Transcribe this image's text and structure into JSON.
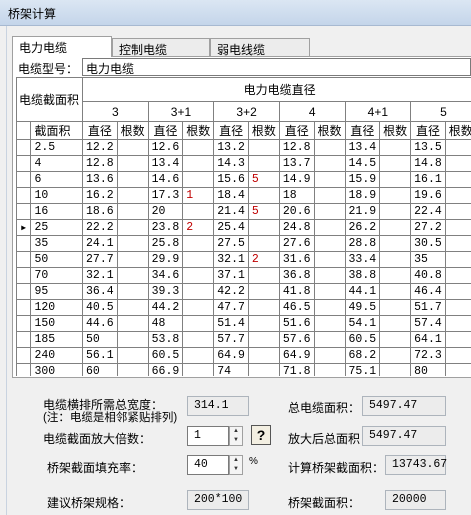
{
  "window": {
    "title": "桥架计算"
  },
  "tabs": [
    {
      "label": "电力电缆",
      "active": true
    },
    {
      "label": "控制电缆",
      "active": false
    },
    {
      "label": "弱电线缆",
      "active": false
    }
  ],
  "cable_type": {
    "label": "电缆型号：",
    "value": "电力电缆"
  },
  "grid": {
    "corner_label": "电缆截面积",
    "group_header": "电力电缆直径",
    "core_columns": [
      "3",
      "3+1",
      "3+2",
      "4",
      "4+1",
      "5"
    ],
    "sub_headers": {
      "area": "截面积",
      "diameter": "直径",
      "count": "根数"
    },
    "rows": [
      {
        "area": "2.5",
        "v": [
          "12.2",
          "",
          "12.6",
          "",
          "13.2",
          "",
          "12.8",
          "",
          "13.4",
          "",
          "13.5",
          ""
        ]
      },
      {
        "area": "4",
        "v": [
          "12.8",
          "",
          "13.4",
          "",
          "14.3",
          "",
          "13.7",
          "",
          "14.5",
          "",
          "14.8",
          ""
        ]
      },
      {
        "area": "6",
        "v": [
          "13.6",
          "",
          "14.6",
          "",
          "15.6",
          "5",
          "14.9",
          "",
          "15.9",
          "",
          "16.1",
          ""
        ]
      },
      {
        "area": "10",
        "v": [
          "16.2",
          "",
          "17.3",
          "1",
          "18.4",
          "",
          "18",
          "",
          "18.9",
          "",
          "19.6",
          ""
        ]
      },
      {
        "area": "16",
        "v": [
          "18.6",
          "",
          "20",
          "",
          "21.4",
          "5",
          "20.6",
          "",
          "21.9",
          "",
          "22.4",
          ""
        ]
      },
      {
        "area": "25",
        "v": [
          "22.2",
          "",
          "23.8",
          "2",
          "25.4",
          "",
          "24.8",
          "",
          "26.2",
          "",
          "27.2",
          ""
        ],
        "current": true
      },
      {
        "area": "35",
        "v": [
          "24.1",
          "",
          "25.8",
          "",
          "27.5",
          "",
          "27.6",
          "",
          "28.8",
          "",
          "30.5",
          ""
        ]
      },
      {
        "area": "50",
        "v": [
          "27.7",
          "",
          "29.9",
          "",
          "32.1",
          "2",
          "31.6",
          "",
          "33.4",
          "",
          "35",
          ""
        ]
      },
      {
        "area": "70",
        "v": [
          "32.1",
          "",
          "34.6",
          "",
          "37.1",
          "",
          "36.8",
          "",
          "38.8",
          "",
          "40.8",
          ""
        ]
      },
      {
        "area": "95",
        "v": [
          "36.4",
          "",
          "39.3",
          "",
          "42.2",
          "",
          "41.8",
          "",
          "44.1",
          "",
          "46.4",
          ""
        ]
      },
      {
        "area": "120",
        "v": [
          "40.5",
          "",
          "44.2",
          "",
          "47.7",
          "",
          "46.5",
          "",
          "49.5",
          "",
          "51.7",
          ""
        ]
      },
      {
        "area": "150",
        "v": [
          "44.6",
          "",
          "48",
          "",
          "51.4",
          "",
          "51.6",
          "",
          "54.1",
          "",
          "57.4",
          ""
        ]
      },
      {
        "area": "185",
        "v": [
          "50",
          "",
          "53.8",
          "",
          "57.7",
          "",
          "57.6",
          "",
          "60.5",
          "",
          "64.1",
          ""
        ]
      },
      {
        "area": "240",
        "v": [
          "56.1",
          "",
          "60.5",
          "",
          "64.9",
          "",
          "64.9",
          "",
          "68.2",
          "",
          "72.3",
          ""
        ]
      },
      {
        "area": "300",
        "v": [
          "60",
          "",
          "66.9",
          "",
          "74",
          "",
          "71.8",
          "",
          "75.1",
          "",
          "80",
          ""
        ]
      }
    ]
  },
  "results": {
    "total_width_label": "电缆横排所需总宽度：",
    "total_width_note": "(注：电缆是相邻紧贴排列)",
    "total_width_value": "314.1",
    "total_area_label": "总电缆面积：",
    "total_area_value": "5497.47",
    "multiplier_label": "电缆截面放大倍数：",
    "multiplier_value": "1",
    "enlarged_area_label": "放大后总面积：",
    "enlarged_area_value": "5497.47",
    "fill_rate_label": "桥架截面填充率：",
    "fill_rate_value": "40",
    "fill_rate_unit": "%",
    "calc_area_label": "计算桥架截面积：",
    "calc_area_value": "13743.67",
    "suggested_spec_label": "建议桥架规格：",
    "suggested_spec_value": "200*100",
    "tray_area_label": "桥架截面积：",
    "tray_area_value": "20000",
    "help_label": "?"
  },
  "icons": {
    "current_row": "row-pointer-icon",
    "spin_up": "spin-up-icon",
    "spin_down": "spin-down-icon",
    "help": "help-icon"
  }
}
